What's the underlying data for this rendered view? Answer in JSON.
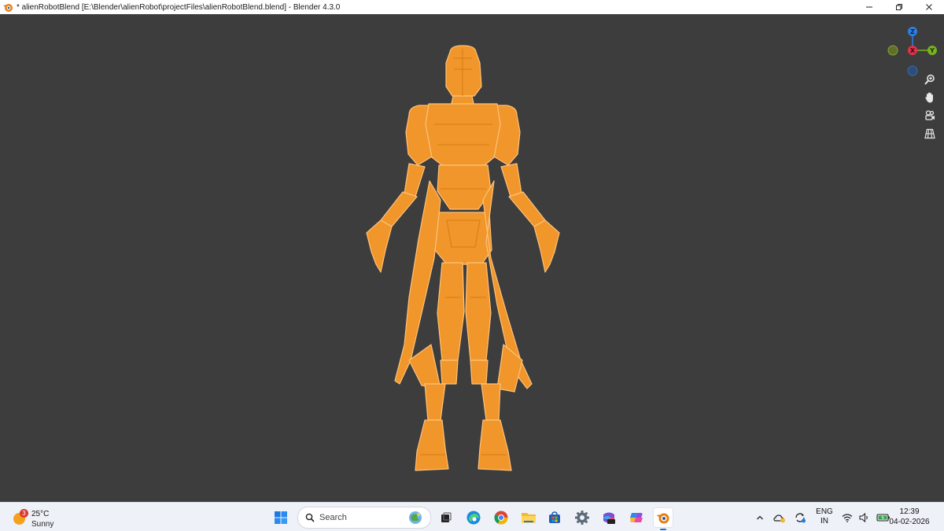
{
  "window": {
    "title": "* alienRobotBlend [E:\\Blender\\alienRobot\\projectFiles\\alienRobotBlend.blend] - Blender 4.3.0",
    "controls": [
      "minimize-icon",
      "restore-icon",
      "close-icon"
    ]
  },
  "viewport": {
    "background": "#3d3d3d",
    "model_color": "#f0962a",
    "gizmo": {
      "z": "Z",
      "x": "X",
      "y": "Y",
      "z_color": "#2f7ee0",
      "x_color": "#e0324a",
      "y_color": "#7ab31f"
    },
    "nav_tools": [
      "zoom-icon",
      "hand-icon",
      "camera-icon",
      "grid-icon"
    ]
  },
  "taskbar": {
    "weather": {
      "badge": "3",
      "temp": "25°C",
      "condition": "Sunny"
    },
    "search_placeholder": "Search",
    "apps": [
      "windows-start-icon",
      "task-view-icon",
      "edge-icon",
      "chrome-icon",
      "file-explorer-icon",
      "store-icon",
      "settings-icon",
      "m365-icon",
      "copilot-icon",
      "blender-icon"
    ],
    "tray": {
      "lang_top": "ENG",
      "lang_bottom": "IN"
    },
    "clock": {
      "time": "12:39",
      "date": "04-02-2026"
    }
  }
}
